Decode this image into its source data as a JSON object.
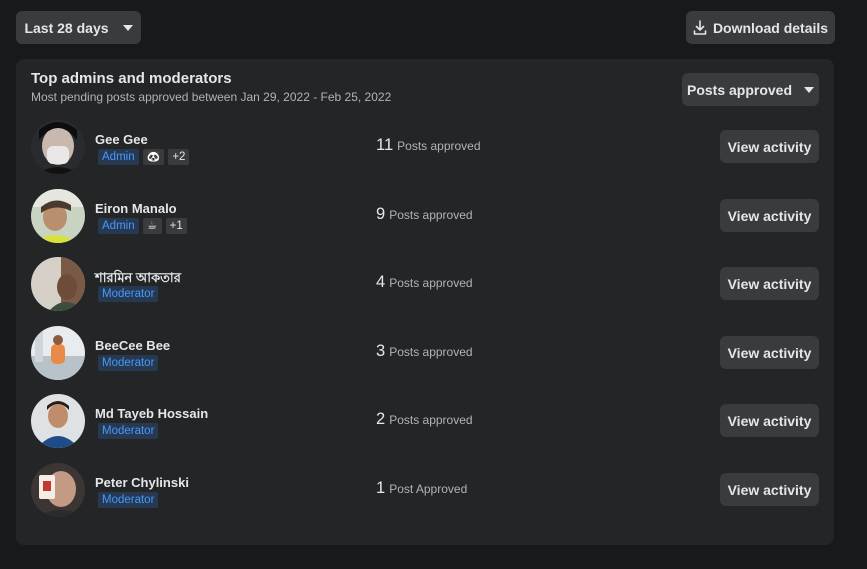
{
  "toolbar": {
    "range_label": "Last 28 days",
    "download_label": "Download details"
  },
  "card": {
    "title": "Top admins and moderators",
    "subtitle": "Most pending posts approved between Jan 29, 2022 - Feb 25, 2022",
    "sort_label": "Posts approved"
  },
  "icons": {
    "caret": "caret-down-icon",
    "download": "download-icon",
    "badge_1": "panda-icon",
    "badge_2": "coffee-cup-icon"
  },
  "colors": {
    "background": "#18191a",
    "card": "#242526",
    "button": "#3a3b3c",
    "role_text": "#4599ff",
    "role_bg": "#263951"
  },
  "members": [
    {
      "name": "Gee Gee",
      "role": "Admin",
      "badge_icon": "🐼",
      "extra": "+2",
      "count": "11",
      "count_label": "Posts approved",
      "action": "View activity"
    },
    {
      "name": "Eiron Manalo",
      "role": "Admin",
      "badge_icon": "☕",
      "extra": "+1",
      "count": "9",
      "count_label": "Posts approved",
      "action": "View activity"
    },
    {
      "name": "শারমিন আকতার",
      "role": "Moderator",
      "count": "4",
      "count_label": "Posts approved",
      "action": "View activity"
    },
    {
      "name": "BeeCee Bee",
      "role": "Moderator",
      "count": "3",
      "count_label": "Posts approved",
      "action": "View activity"
    },
    {
      "name": "Md Tayeb Hossain",
      "role": "Moderator",
      "count": "2",
      "count_label": "Posts approved",
      "action": "View activity"
    },
    {
      "name": "Peter Chylinski",
      "role": "Moderator",
      "count": "1",
      "count_label": "Post Approved",
      "action": "View activity"
    }
  ]
}
